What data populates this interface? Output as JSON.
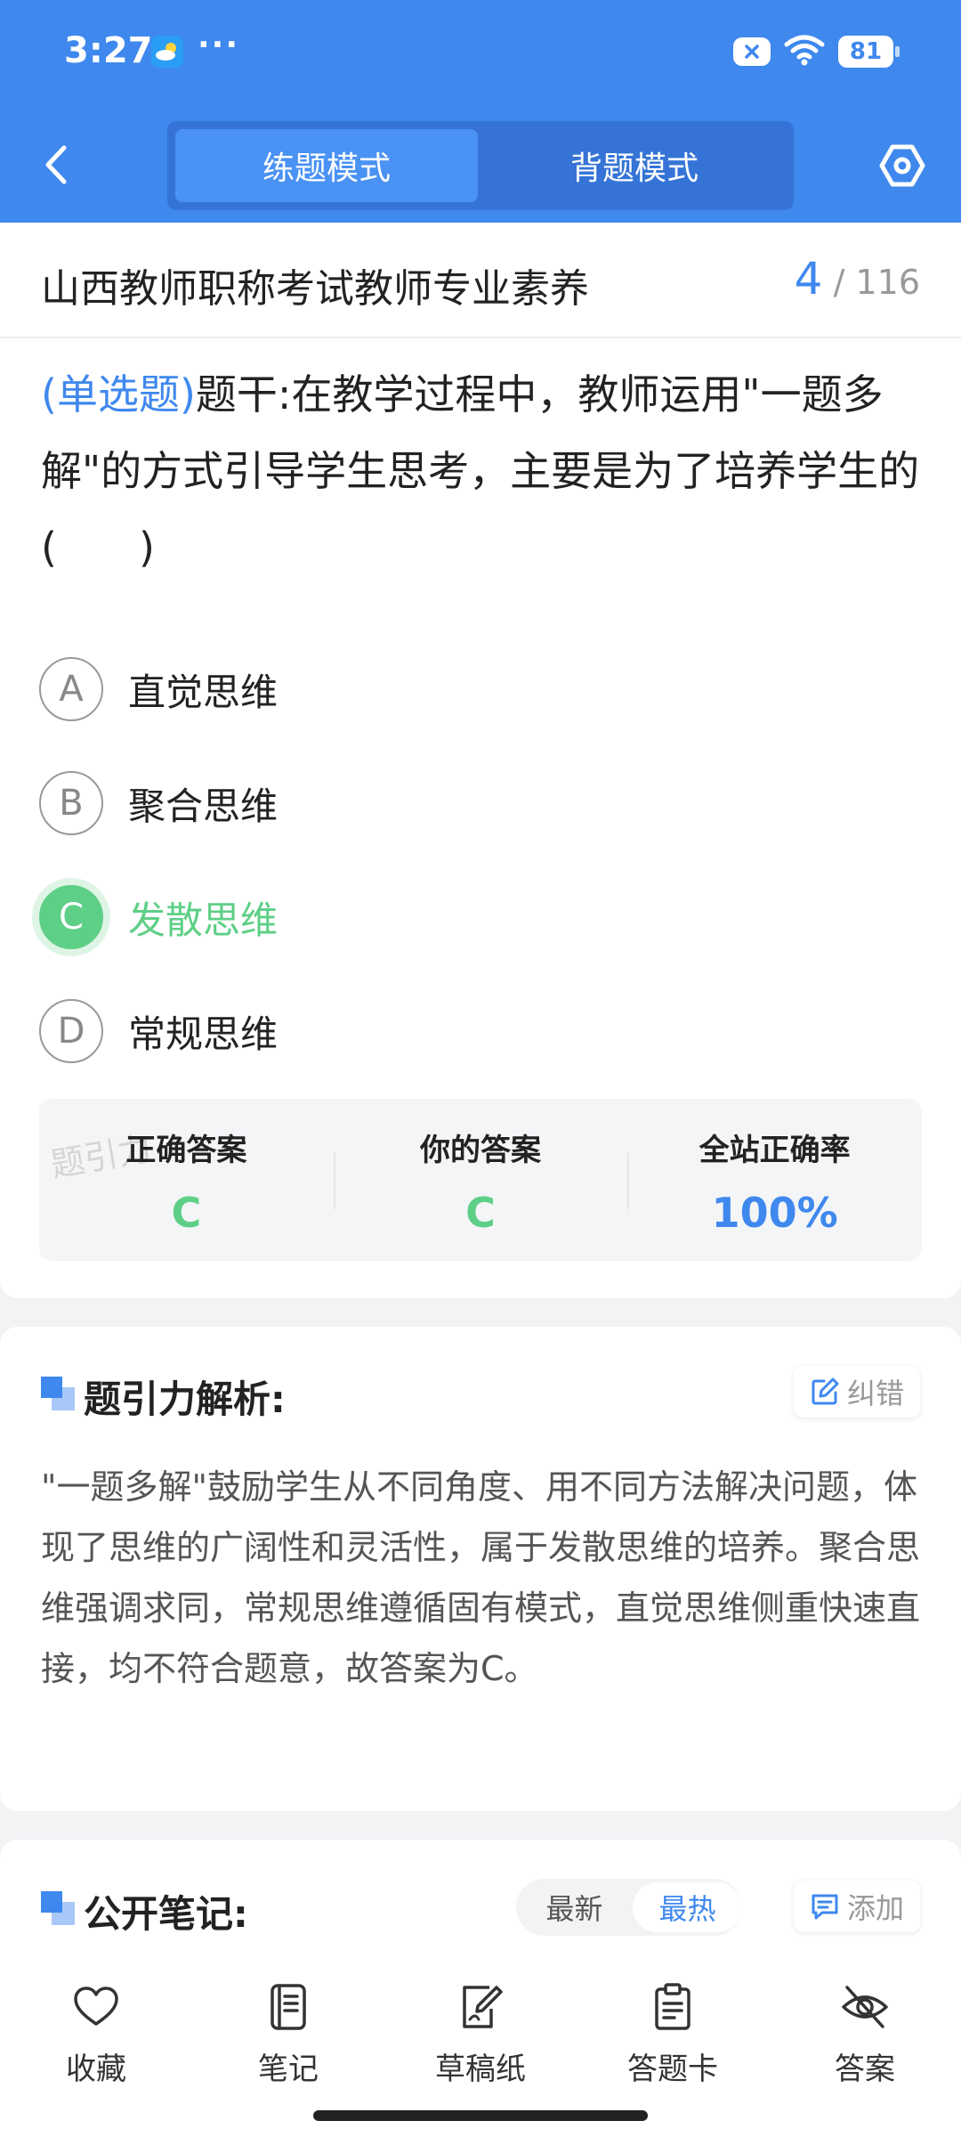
{
  "status": {
    "time": "3:27",
    "more": "···",
    "battery": "81"
  },
  "header": {
    "tabs": [
      {
        "label": "练题模式",
        "active": true
      },
      {
        "label": "背题模式",
        "active": false
      }
    ]
  },
  "exam": {
    "title": "山西教师职称考试教师专业素养",
    "current": "4",
    "total": "/ 116"
  },
  "question": {
    "type": "(单选题)",
    "stem": "题干:在教学过程中，教师运用\"一题多解\"的方式引导学生思考，主要是为了培养学生的(　　)"
  },
  "options": [
    {
      "letter": "A",
      "text": "直觉思维"
    },
    {
      "letter": "B",
      "text": "聚合思维"
    },
    {
      "letter": "C",
      "text": "发散思维",
      "state": "correct"
    },
    {
      "letter": "D",
      "text": "常规思维"
    }
  ],
  "answer_summary": {
    "correct_label": "正确答案",
    "correct_value": "C",
    "yours_label": "你的答案",
    "yours_value": "C",
    "rate_label": "全站正确率",
    "rate_value": "100%",
    "watermark": "题引力"
  },
  "analysis": {
    "title": "题引力解析:",
    "report_label": "纠错",
    "text": "\"一题多解\"鼓励学生从不同角度、用不同方法解决问题，体现了思维的广阔性和灵活性，属于发散思维的培养。聚合思维强调求同，常规思维遵循固有模式，直觉思维侧重快速直接，均不符合题意，故答案为C。"
  },
  "notes": {
    "title": "公开笔记:",
    "sort": [
      "最新",
      "最热"
    ],
    "sort_active": "最热",
    "add_label": "添加"
  },
  "bottom_nav": [
    {
      "label": "收藏",
      "icon": "heart-icon"
    },
    {
      "label": "笔记",
      "icon": "notebook-icon"
    },
    {
      "label": "草稿纸",
      "icon": "draft-paper-icon"
    },
    {
      "label": "答题卡",
      "icon": "answer-sheet-icon"
    },
    {
      "label": "答案",
      "icon": "eye-off-icon"
    }
  ],
  "colors": {
    "primary": "#3f88ee",
    "correct": "#5ecf86"
  }
}
